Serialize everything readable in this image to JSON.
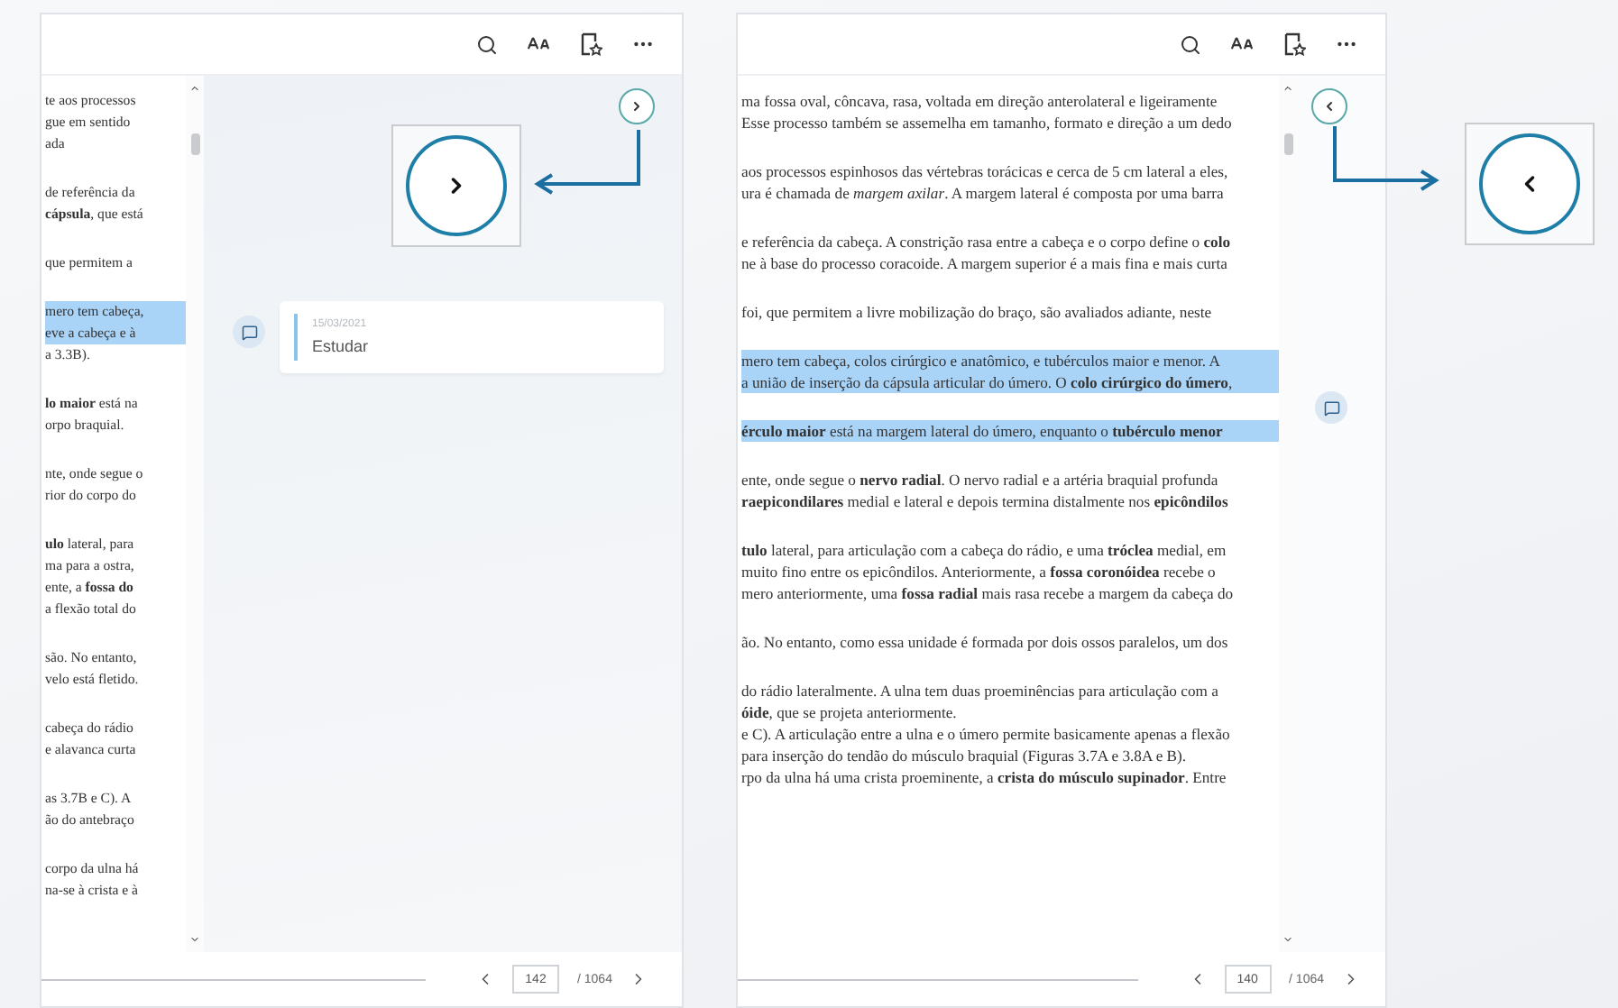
{
  "panels": [
    {
      "sidebar_open": true,
      "paragraphs": [
        {
          "lines": [
            {
              "text": "te aos processos",
              "highlighted": false
            },
            {
              "text": "gue em sentido",
              "highlighted": false
            },
            {
              "text": "ada",
              "highlighted": false
            }
          ]
        },
        {
          "lines": [
            {
              "text": "de referência da",
              "highlighted": false
            },
            {
              "text": "**cápsula**, que está",
              "highlighted": false
            }
          ]
        },
        {
          "lines": [
            {
              "text": "que permitem a",
              "highlighted": false
            }
          ]
        },
        {
          "lines": [
            {
              "text": "mero tem cabeça,",
              "highlighted": true
            },
            {
              "text": "eve a cabeça e à",
              "highlighted": true
            },
            {
              "text": "a 3.3B).",
              "highlighted": false
            }
          ]
        },
        {
          "lines": [
            {
              "text": "**lo maior** está na",
              "highlighted": false
            },
            {
              "text": "orpo braquial.",
              "highlighted": false
            }
          ]
        },
        {
          "lines": [
            {
              "text": "nte, onde segue o",
              "highlighted": false
            },
            {
              "text": "rior do corpo do",
              "highlighted": false
            }
          ]
        },
        {
          "lines": [
            {
              "text": "**ulo** lateral, para",
              "highlighted": false
            },
            {
              "text": "ma para a ostra,",
              "highlighted": false
            },
            {
              "text": "ente, a **fossa do**",
              "highlighted": false
            },
            {
              "text": "a flexão total do",
              "highlighted": false
            }
          ]
        },
        {
          "lines": [
            {
              "text": "são. No entanto,",
              "highlighted": false
            },
            {
              "text": "velo está fletido.",
              "highlighted": false
            }
          ]
        },
        {
          "lines": [
            {
              "text": "cabeça do rádio",
              "highlighted": false
            },
            {
              "text": "e alavanca curta",
              "highlighted": false
            }
          ]
        },
        {
          "lines": [
            {
              "text": "as 3.7B e C). A",
              "highlighted": false
            },
            {
              "text": "ão do antebraço",
              "highlighted": false
            }
          ]
        },
        {
          "lines": [
            {
              "text": "corpo da ulna há",
              "highlighted": false
            },
            {
              "text": "na-se à crista e à",
              "highlighted": false
            }
          ]
        }
      ],
      "notes": [
        {
          "date": "15/03/2021",
          "text": "Estudar"
        }
      ],
      "page": {
        "current": "142",
        "total": "/ 1064"
      }
    },
    {
      "sidebar_open": false,
      "paragraphs": [
        {
          "lines": [
            {
              "text": "ma fossa oval, côncava, rasa, voltada em direção anterolateral e ligeiramente",
              "highlighted": false
            },
            {
              "text": "Esse processo também se assemelha em tamanho, formato e direção a um dedo",
              "highlighted": false
            }
          ]
        },
        {
          "lines": [
            {
              "text": "aos processos espinhosos das vértebras torácicas e cerca de 5 cm lateral a eles,",
              "highlighted": false
            },
            {
              "text": "ura é chamada de *margem axilar*. A margem lateral é composta por uma barra",
              "highlighted": false
            }
          ]
        },
        {
          "lines": [
            {
              "text": "e referência da cabeça. A constrição rasa entre a cabeça e o corpo define o **colo**",
              "highlighted": false
            },
            {
              "text": "ne à base do processo coracoide. A margem superior é a mais fina e mais curta",
              "highlighted": false
            }
          ]
        },
        {
          "lines": [
            {
              "text": "foi, que permitem a livre mobilização do braço, são avaliados adiante, neste",
              "highlighted": false
            }
          ]
        },
        {
          "lines": [
            {
              "text": "mero tem cabeça, colos cirúrgico e anatômico, e tubérculos maior e menor. A",
              "highlighted": true
            },
            {
              "text": "a união de inserção da cápsula articular do úmero. O **colo cirúrgico do úmero**,",
              "highlighted": true
            }
          ]
        },
        {
          "lines": [
            {
              "text": "**érculo maior** está na margem lateral do úmero, enquanto o **tubérculo menor**",
              "highlighted": true
            }
          ]
        },
        {
          "lines": [
            {
              "text": "ente, onde segue o **nervo radial**. O nervo radial e a artéria braquial profunda",
              "highlighted": false
            },
            {
              "text": "**raepicondilares** medial e lateral e depois termina distalmente nos **epicôndilos**",
              "highlighted": false
            }
          ]
        },
        {
          "lines": [
            {
              "text": "**tulo** lateral, para articulação com a cabeça do rádio, e uma **tróclea** medial, em",
              "highlighted": false
            },
            {
              "text": "muito fino entre os epicôndilos. Anteriormente, a **fossa coronóidea** recebe o",
              "highlighted": false
            },
            {
              "text": "mero anteriormente, uma **fossa radial** mais rasa recebe a margem da cabeça do",
              "highlighted": false
            }
          ]
        },
        {
          "lines": [
            {
              "text": "ão. No entanto, como essa unidade é formada por dois ossos paralelos, um dos",
              "highlighted": false
            }
          ]
        },
        {
          "lines": [
            {
              "text": "do rádio lateralmente. A ulna tem duas proeminências para articulação com a",
              "highlighted": false
            },
            {
              "text": "**óide**, que se projeta anteriormente.",
              "highlighted": false
            },
            {
              "text": "e C). A articulação entre a ulna e o úmero permite basicamente apenas a flexão",
              "highlighted": false
            },
            {
              "text": "para inserção do tendão do músculo braquial (Figuras 3.7A e 3.8A e B).",
              "highlighted": false
            },
            {
              "text": "rpo da ulna há uma crista proeminente, a **crista do músculo supinador**. Entre",
              "highlighted": false
            }
          ]
        }
      ],
      "page": {
        "current": "140",
        "total": "/ 1064"
      }
    }
  ]
}
